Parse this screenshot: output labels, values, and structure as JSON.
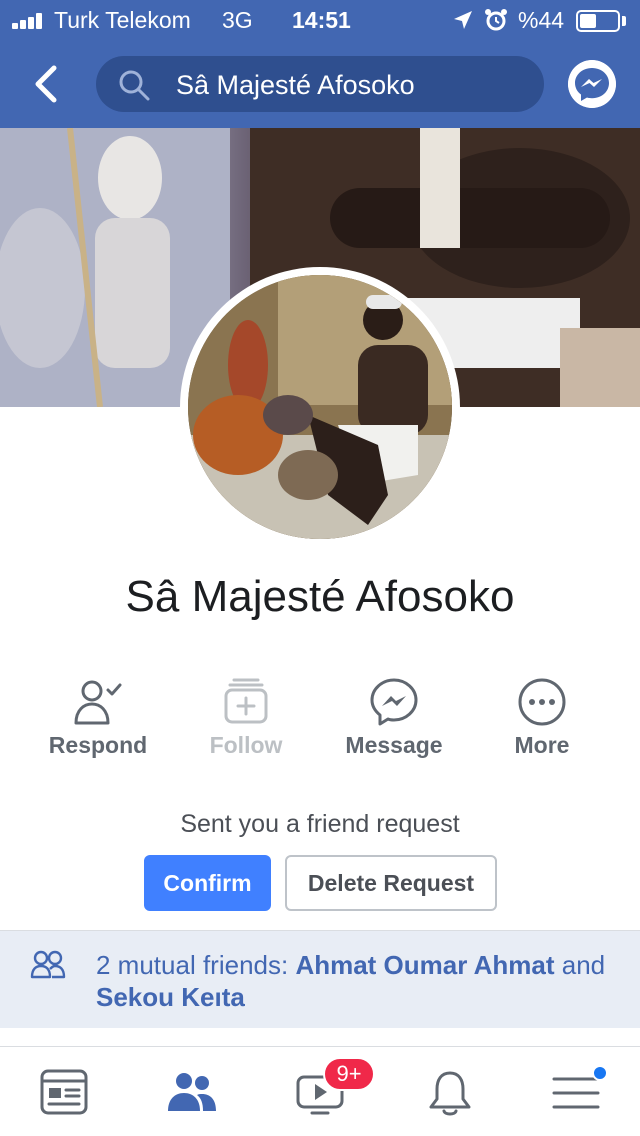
{
  "status_bar": {
    "carrier": "Turk Telekom",
    "network": "3G",
    "time": "14:51",
    "battery_percent": "%44",
    "battery_level": 0.44,
    "icons": [
      "signal-icon",
      "location-arrow-icon",
      "alarm-icon",
      "battery-icon"
    ]
  },
  "nav": {
    "back_icon": "chevron-left-icon",
    "search_value": "Sâ Majesté Afosoko",
    "search_icon": "search-icon",
    "messenger_icon": "messenger-icon"
  },
  "profile": {
    "name": "Sâ Majesté Afosoko"
  },
  "actions": [
    {
      "label": "Respond",
      "icon": "person-check-icon",
      "enabled": true
    },
    {
      "label": "Follow",
      "icon": "follow-stack-plus-icon",
      "enabled": false
    },
    {
      "label": "Message",
      "icon": "messenger-icon",
      "enabled": true
    },
    {
      "label": "More",
      "icon": "more-dots-icon",
      "enabled": true
    }
  ],
  "friend_request": {
    "text": "Sent you a friend request",
    "confirm_label": "Confirm",
    "delete_label": "Delete Request"
  },
  "mutual_friends": {
    "prefix": "2 mutual friends: ",
    "friend_1": "Ahmat Oumar Ahmat",
    "connector": " and ",
    "friend_2": "Sekou Keıta",
    "icon": "friends-icon"
  },
  "tabbar": {
    "items": [
      {
        "name": "news-feed",
        "icon": "news-feed-icon"
      },
      {
        "name": "friends",
        "icon": "friends-icon",
        "active": true
      },
      {
        "name": "watch",
        "icon": "watch-video-icon"
      },
      {
        "name": "notifications",
        "icon": "bell-icon"
      },
      {
        "name": "menu",
        "icon": "menu-icon"
      }
    ],
    "watch_badge": "9+"
  },
  "colors": {
    "brand_blue": "#4267b2",
    "confirm_blue": "#4080ff",
    "badge_red": "#f02849",
    "muted_text": "#606770",
    "mutual_bg": "#e8edf5"
  }
}
